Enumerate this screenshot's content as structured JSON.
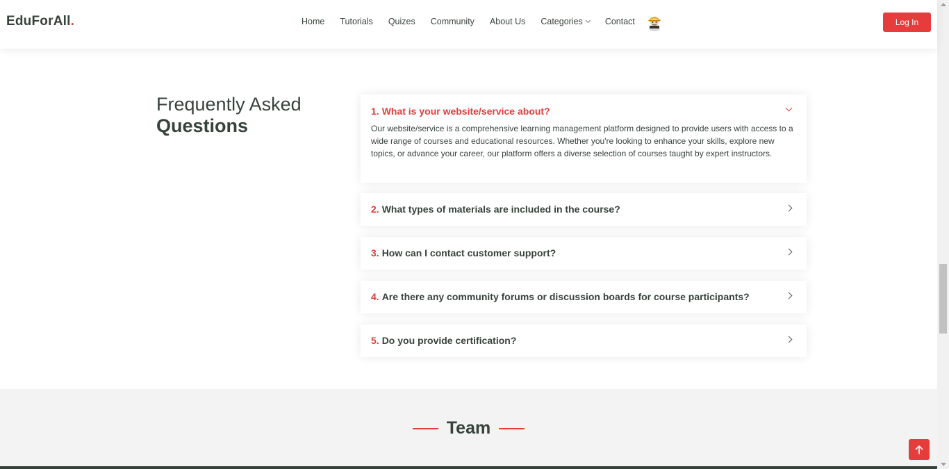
{
  "header": {
    "logo": "EduForAll",
    "logo_dot": ".",
    "nav": [
      {
        "label": "Home"
      },
      {
        "label": "Tutorials"
      },
      {
        "label": "Quizes"
      },
      {
        "label": "Community"
      },
      {
        "label": "About Us"
      },
      {
        "label": "Categories",
        "has_dropdown": true
      },
      {
        "label": "Contact"
      }
    ],
    "login_label": "Log In"
  },
  "faq": {
    "title_light": "Frequently Asked",
    "title_bold": "Questions",
    "items": [
      {
        "number": "1.",
        "question": "What is your website/service about?",
        "expanded": true,
        "answer": "Our website/service is a comprehensive learning management platform designed to provide users with access to a wide range of courses and educational resources. Whether you're looking to enhance your skills, explore new topics, or advance your career, our platform offers a diverse selection of courses taught by expert instructors."
      },
      {
        "number": "2.",
        "question": "What types of materials are included in the course?",
        "expanded": false
      },
      {
        "number": "3.",
        "question": "How can I contact customer support?",
        "expanded": false
      },
      {
        "number": "4.",
        "question": "Are there any community forums or discussion boards for course participants?",
        "expanded": false
      },
      {
        "number": "5.",
        "question": "Do you provide certification?",
        "expanded": false
      }
    ]
  },
  "team": {
    "title": "Team"
  },
  "colors": {
    "accent": "#e63c3c",
    "text": "#37423b",
    "section_bg": "#f3f3f3"
  },
  "icons": {
    "avatar": "user-avatar-icon",
    "back_to_top": "arrow-up-icon",
    "categories_dropdown": "chevron-down-icon",
    "faq_collapsed": "chevron-right-icon",
    "faq_expanded": "chevron-down-icon"
  }
}
